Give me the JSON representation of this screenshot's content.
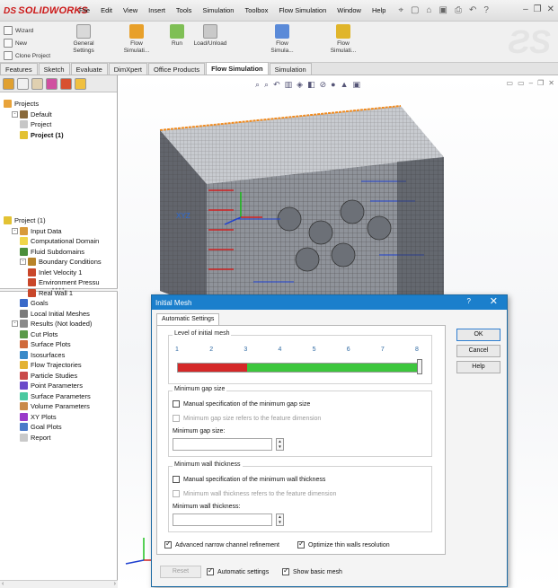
{
  "app": {
    "logo": "SOLIDWORKS",
    "logo_ds": "DS"
  },
  "menu": [
    "File",
    "Edit",
    "View",
    "Insert",
    "Tools",
    "Simulation",
    "Toolbox",
    "Flow Simulation",
    "Window",
    "Help"
  ],
  "toolbar": {
    "wizard": "Wizard",
    "new": "New",
    "clone_project": "Clone Project",
    "general_settings": "General Settings",
    "flow_simulation_1": "Flow Simulati...",
    "run": "Run",
    "load_unload": "Load/Unload",
    "flow_simulation_2": "Flow Simula...",
    "flow_simulation_3": "Flow Simulati..."
  },
  "command_tabs": [
    {
      "label": "Features",
      "active": false
    },
    {
      "label": "Sketch",
      "active": false
    },
    {
      "label": "Evaluate",
      "active": false
    },
    {
      "label": "DimXpert",
      "active": false
    },
    {
      "label": "Office Products",
      "active": false
    },
    {
      "label": "Flow Simulation",
      "active": true
    },
    {
      "label": "Simulation",
      "active": false
    }
  ],
  "projects_tree": [
    {
      "label": "Projects",
      "indent": 0,
      "icon_color": "#e8a33a",
      "exp": "",
      "bold": false
    },
    {
      "label": "Default",
      "indent": 1,
      "icon_color": "#8a6a3a",
      "exp": "-",
      "bold": false
    },
    {
      "label": "Project",
      "indent": 2,
      "icon_color": "#c7c7c7",
      "exp": "",
      "bold": false
    },
    {
      "label": "Project (1)",
      "indent": 2,
      "icon_color": "#e3c233",
      "exp": "",
      "bold": true
    }
  ],
  "analysis_tree": [
    {
      "label": "Project (1)",
      "indent": 0,
      "icon_color": "#e3c233",
      "exp": "",
      "bold": false
    },
    {
      "label": "Input Data",
      "indent": 1,
      "icon_color": "#d89a3a",
      "exp": "-",
      "bold": false
    },
    {
      "label": "Computational Domain",
      "indent": 2,
      "icon_color": "#f0d64a",
      "exp": "",
      "bold": false
    },
    {
      "label": "Fluid Subdomains",
      "indent": 2,
      "icon_color": "#4c8f3a",
      "exp": "",
      "bold": false
    },
    {
      "label": "Boundary Conditions",
      "indent": 2,
      "icon_color": "#b8842a",
      "exp": "-",
      "bold": false
    },
    {
      "label": "Inlet Velocity 1",
      "indent": 3,
      "icon_color": "#c9472a",
      "exp": "",
      "bold": false
    },
    {
      "label": "Environment Pressu",
      "indent": 3,
      "icon_color": "#c9472a",
      "exp": "",
      "bold": false
    },
    {
      "label": "Real Wall 1",
      "indent": 3,
      "icon_color": "#c9472a",
      "exp": "",
      "bold": false
    },
    {
      "label": "Goals",
      "indent": 2,
      "icon_color": "#3a6ac9",
      "exp": "",
      "bold": false
    },
    {
      "label": "Local Initial Meshes",
      "indent": 2,
      "icon_color": "#7a7a7a",
      "exp": "",
      "bold": false
    },
    {
      "label": "Results (Not loaded)",
      "indent": 1,
      "icon_color": "#8a8a8a",
      "exp": "-",
      "bold": false
    },
    {
      "label": "Cut Plots",
      "indent": 2,
      "icon_color": "#5a9a4a",
      "exp": "",
      "bold": false
    },
    {
      "label": "Surface Plots",
      "indent": 2,
      "icon_color": "#d06a3a",
      "exp": "",
      "bold": false
    },
    {
      "label": "Isosurfaces",
      "indent": 2,
      "icon_color": "#3a8ac9",
      "exp": "",
      "bold": false
    },
    {
      "label": "Flow Trajectories",
      "indent": 2,
      "icon_color": "#e3b233",
      "exp": "",
      "bold": false
    },
    {
      "label": "Particle Studies",
      "indent": 2,
      "icon_color": "#c94a4a",
      "exp": "",
      "bold": false
    },
    {
      "label": "Point Parameters",
      "indent": 2,
      "icon_color": "#6a4ac9",
      "exp": "",
      "bold": false
    },
    {
      "label": "Surface Parameters",
      "indent": 2,
      "icon_color": "#4ac9a0",
      "exp": "",
      "bold": false
    },
    {
      "label": "Volume Parameters",
      "indent": 2,
      "icon_color": "#c98a4a",
      "exp": "",
      "bold": false
    },
    {
      "label": "XY Plots",
      "indent": 2,
      "icon_color": "#9a3ac9",
      "exp": "",
      "bold": false
    },
    {
      "label": "Goal Plots",
      "indent": 2,
      "icon_color": "#4a7ac9",
      "exp": "",
      "bold": false
    },
    {
      "label": "Report",
      "indent": 2,
      "icon_color": "#c9c9c9",
      "exp": "",
      "bold": false
    }
  ],
  "viewport": {
    "axis_label": "XYZ"
  },
  "dialog": {
    "title": "Initial Mesh",
    "help_glyph": "?",
    "close_glyph": "✕",
    "tab": "Automatic Settings",
    "level_group_title": "Level of initial mesh",
    "level_ticks": [
      "1",
      "2",
      "3",
      "4",
      "5",
      "6",
      "7",
      "8"
    ],
    "level_value": 8,
    "gap_group_title": "Minimum gap size",
    "gap_manual": "Manual specification of the minimum gap size",
    "gap_feature": "Minimum gap size refers to the feature dimension",
    "gap_label": "Minimum gap size:",
    "gap_value": "",
    "wall_group_title": "Minimum wall thickness",
    "wall_manual": "Manual specification of the minimum wall thickness",
    "wall_feature": "Minimum wall thickness refers to the feature dimension",
    "wall_label": "Minimum wall thickness:",
    "wall_value": "",
    "advanced_narrow": "Advanced narrow channel refinement",
    "optimize_thin": "Optimize thin walls resolution",
    "ok": "OK",
    "cancel": "Cancel",
    "help": "Help",
    "reset": "Reset",
    "automatic_settings": "Automatic settings",
    "show_basic_mesh": "Show basic mesh"
  }
}
